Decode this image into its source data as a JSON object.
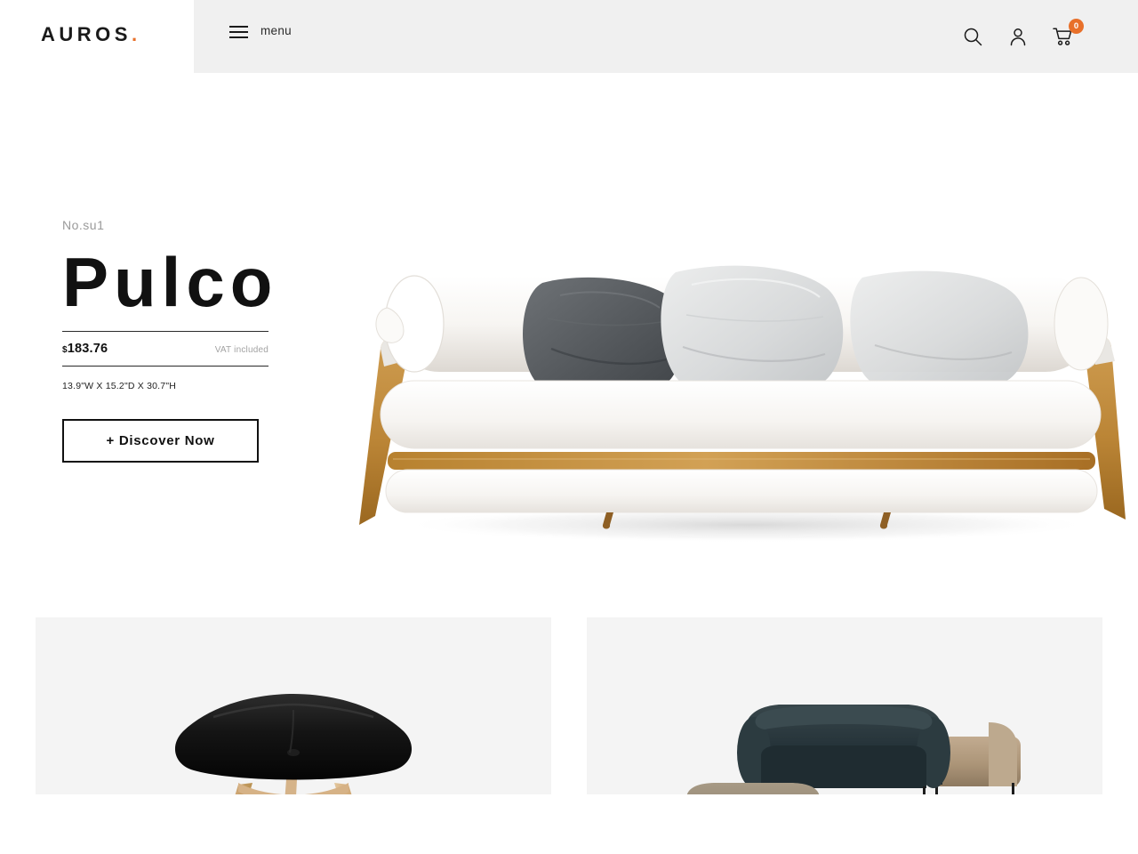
{
  "brand": {
    "name": "AUROS",
    "dot": ".",
    "accent_color": "#e8702a"
  },
  "header": {
    "menu_label": "menu",
    "menu_icon": "hamburger-icon",
    "search_icon": "search-icon",
    "account_icon": "user-icon",
    "cart_icon": "cart-icon",
    "cart_count": "0",
    "background_left": "#ffffff",
    "background_panel": "#f0f0f0"
  },
  "hero": {
    "product_ref": "No.su1",
    "product_title": "Pulco",
    "currency_symbol": "$",
    "price": "183.76",
    "vat_note": "VAT included",
    "dimensions": "13.9\"W X 15.2\"D X 30.7\"H",
    "cta_label": "+ Discover Now",
    "image_name": "pulco-sofa-daybed",
    "carousel": {
      "total": 4,
      "active_index": 0,
      "active_color": "#555555",
      "inactive_color": "#d4d4d4"
    }
  },
  "cards": [
    {
      "name": "black-stool-card",
      "image_name": "black-upholstered-stool-wooden-legs",
      "background": "#f4f4f4"
    },
    {
      "name": "green-sofa-card",
      "image_name": "dark-green-sofa-with-beige-ottoman-and-bench",
      "background": "#f4f4f4"
    }
  ]
}
